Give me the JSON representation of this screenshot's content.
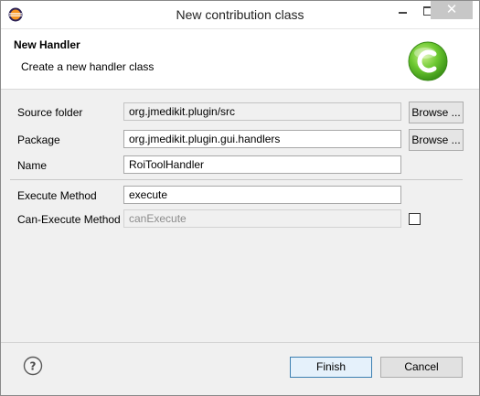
{
  "window": {
    "title": "New contribution class"
  },
  "banner": {
    "title": "New Handler",
    "description": "Create a new handler class"
  },
  "form": {
    "source_folder": {
      "label": "Source folder",
      "value": "org.jmedikit.plugin/src",
      "browse_label": "Browse ..."
    },
    "package": {
      "label": "Package",
      "value": "org.jmedikit.plugin.gui.handlers",
      "browse_label": "Browse ..."
    },
    "name": {
      "label": "Name",
      "value": "RoiToolHandler"
    },
    "execute_method": {
      "label": "Execute Method",
      "value": "execute"
    },
    "can_execute_method": {
      "label": "Can-Execute Method",
      "value": "canExecute",
      "checked": false
    }
  },
  "footer": {
    "finish_label": "Finish",
    "cancel_label": "Cancel"
  },
  "icons": {
    "app": "eclipse-icon",
    "banner": "class-c-icon",
    "help": "help-icon",
    "minimize": "minimize-icon",
    "maximize": "maximize-icon",
    "close": "close-icon"
  },
  "colors": {
    "banner_icon_green": "#5cbf2a",
    "default_button_border": "#3c7fb1"
  }
}
